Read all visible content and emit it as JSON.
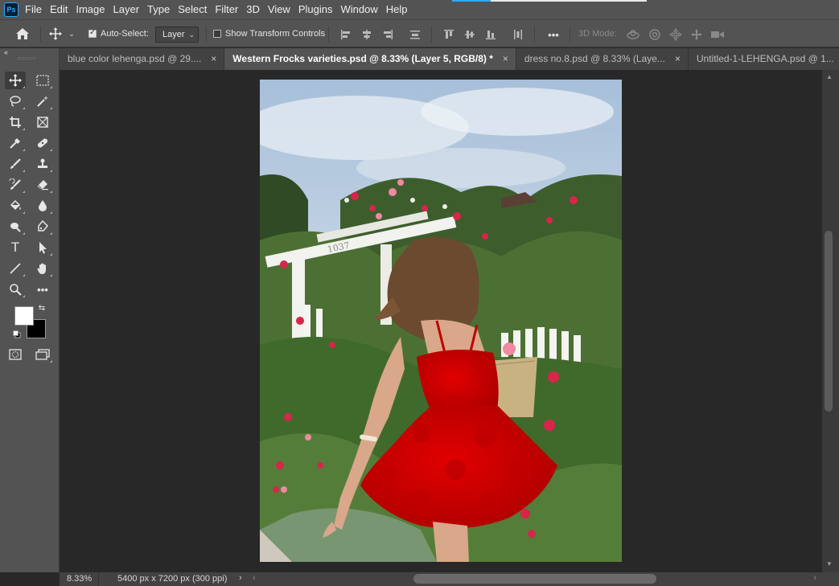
{
  "app": {
    "logo_text": "Ps",
    "menu": [
      "File",
      "Edit",
      "Image",
      "Layer",
      "Type",
      "Select",
      "Filter",
      "3D",
      "View",
      "Plugins",
      "Window",
      "Help"
    ]
  },
  "options": {
    "auto_select_label": "Auto-Select:",
    "auto_select_checked": true,
    "auto_select_target": "Layer",
    "transform_controls_label": "Show Transform Controls",
    "transform_controls_checked": false,
    "mode_3d_label": "3D Mode:",
    "more_label": "•••"
  },
  "tabs": [
    {
      "title": "blue color lehenga.psd @ 29....",
      "active": false
    },
    {
      "title": "Western Frocks varieties.psd @ 8.33% (Layer 5, RGB/8) *",
      "active": true
    },
    {
      "title": "dress no.8.psd @ 8.33% (Laye...",
      "active": false
    },
    {
      "title": "Untitled-1-LEHENGA.psd @ 1...",
      "active": false
    }
  ],
  "tab_close_glyph": "×",
  "tools": {
    "colors": {
      "foreground": "#ffffff",
      "background": "#000000"
    },
    "text_tool_glyph": "T"
  },
  "document": {
    "gate_number": "1037"
  },
  "status": {
    "zoom": "8.33%",
    "doc_info": "5400 px x 7200 px (300 ppi)",
    "arrow": "›",
    "scroll_left": "‹",
    "scroll_right": "›"
  },
  "colors": {
    "accent": "#31a8ff",
    "dress": "#d80000",
    "sky": "#b9cde3"
  }
}
